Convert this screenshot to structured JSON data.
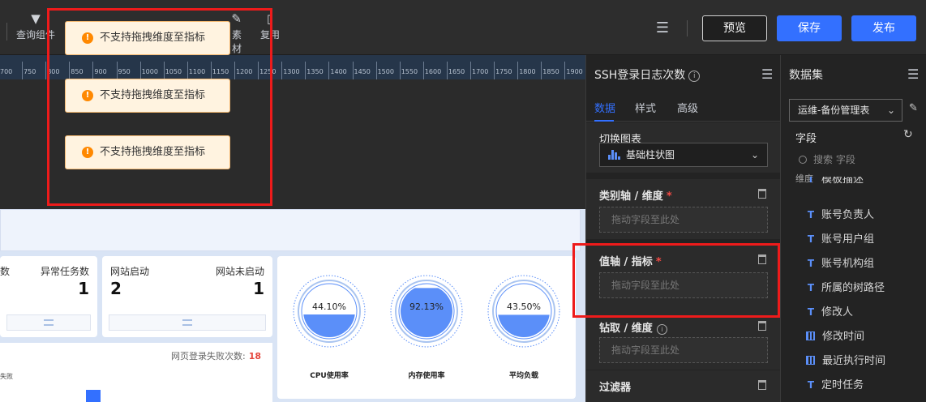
{
  "toolbar": {
    "items": [
      {
        "label": "查询组件",
        "icon": "filter-icon"
      },
      {
        "label": "素材",
        "icon": "material-icon"
      },
      {
        "label": "复用",
        "icon": "reuse-icon"
      }
    ],
    "preview_label": "预览",
    "save_label": "保存",
    "publish_label": "发布"
  },
  "ruler": {
    "ticks": [
      "700",
      "750",
      "800",
      "850",
      "900",
      "950",
      "1000",
      "1050",
      "1100",
      "1150",
      "1200",
      "1250",
      "1300",
      "1350",
      "1400",
      "1450",
      "1500",
      "1550",
      "1600",
      "1650",
      "1700",
      "1750",
      "1800",
      "1850",
      "1900"
    ]
  },
  "toasts": [
    {
      "text": "不支持拖拽维度至指标"
    },
    {
      "text": "不支持拖拽维度至指标"
    },
    {
      "text": "不支持拖拽维度至指标"
    }
  ],
  "dashboard": {
    "cards": [
      {
        "label_left": "数",
        "label_right": "异常任务数",
        "value": "1"
      },
      {
        "label_left": "网站启动",
        "label_right": "网站未启动",
        "value_left": "2",
        "value_right": "1"
      }
    ],
    "gauges": [
      {
        "label": "CPU使用率",
        "text": "44.10%",
        "value": 0.441
      },
      {
        "label": "内存使用率",
        "text": "92.13%",
        "value": 0.9213
      },
      {
        "label": "平均负载",
        "text": "43.50%",
        "value": 0.435
      }
    ],
    "line_title": "网页登录失败次数:",
    "line_value": "18",
    "line_series": "失败"
  },
  "property_panel": {
    "title": "SSH登录日志次数",
    "tabs": [
      "数据",
      "样式",
      "高级"
    ],
    "switch_chart_label": "切换图表",
    "chart_type": "基础柱状图",
    "sections": [
      {
        "title": "类别轴 / 维度",
        "required": "*",
        "placeholder": "拖动字段至此处"
      },
      {
        "title": "值轴 / 指标",
        "required": "*",
        "placeholder": "拖动字段至此处"
      },
      {
        "title": "钻取 / 维度",
        "required": "",
        "placeholder": "拖动字段至此处"
      },
      {
        "title": "过滤器",
        "required": "",
        "placeholder": ""
      }
    ]
  },
  "dataset_panel": {
    "title": "数据集",
    "dataset": "运维-备份管理表",
    "fields_label": "字段",
    "search_placeholder": "搜索 字段",
    "group_label": "维度",
    "fields": [
      {
        "type": "T",
        "name": "模板描述"
      },
      {
        "type": "T",
        "name": "账号负责人"
      },
      {
        "type": "T",
        "name": "账号用户组"
      },
      {
        "type": "T",
        "name": "账号机构组"
      },
      {
        "type": "T",
        "name": "所属的树路径"
      },
      {
        "type": "T",
        "name": "修改人"
      },
      {
        "type": "date",
        "name": "修改时间"
      },
      {
        "type": "date",
        "name": "最近执行时间"
      },
      {
        "type": "T",
        "name": "定时任务"
      }
    ]
  },
  "colors": {
    "accent": "#3370ff",
    "warning": "#ff8800",
    "highlight": "#ee1b1b",
    "required": "#f54a45"
  }
}
